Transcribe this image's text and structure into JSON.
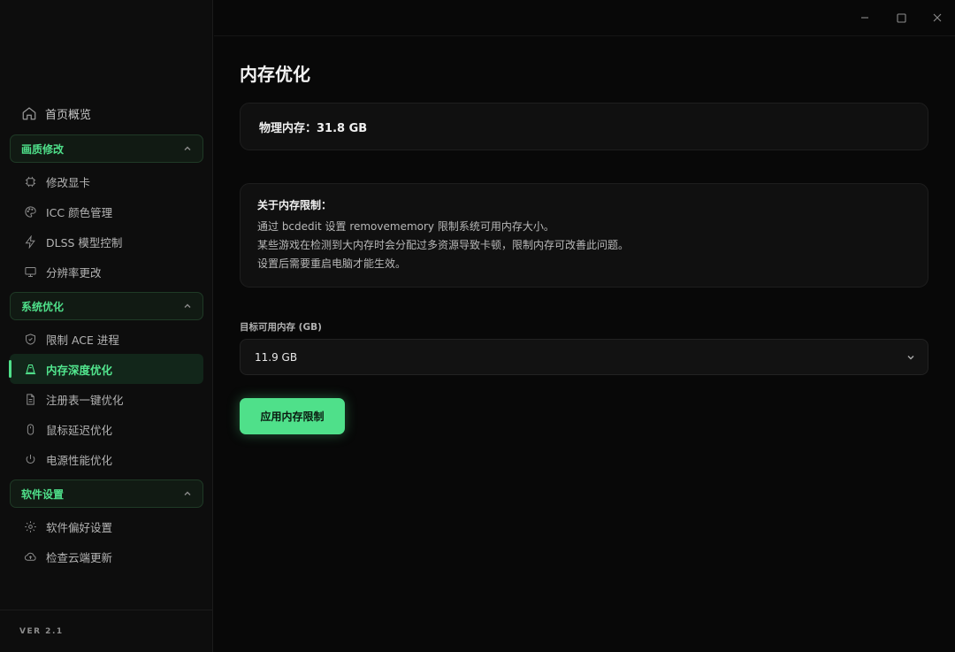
{
  "sidebar": {
    "home": {
      "label": "首页概览",
      "icon": "home-icon"
    },
    "groups": [
      {
        "label": "画质修改",
        "items": [
          {
            "label": "修改显卡",
            "icon": "chip-icon"
          },
          {
            "label": "ICC 颜色管理",
            "icon": "palette-icon"
          },
          {
            "label": "DLSS 模型控制",
            "icon": "lightning-icon"
          },
          {
            "label": "分辨率更改",
            "icon": "monitor-icon"
          }
        ]
      },
      {
        "label": "系统优化",
        "items": [
          {
            "label": "限制 ACE 进程",
            "icon": "shield-icon"
          },
          {
            "label": "内存深度优化",
            "icon": "memory-icon",
            "active": true
          },
          {
            "label": "注册表一键优化",
            "icon": "document-icon"
          },
          {
            "label": "鼠标延迟优化",
            "icon": "mouse-icon"
          },
          {
            "label": "电源性能优化",
            "icon": "power-icon"
          }
        ]
      },
      {
        "label": "软件设置",
        "items": [
          {
            "label": "软件偏好设置",
            "icon": "gear-icon"
          },
          {
            "label": "检查云端更新",
            "icon": "cloud-upload-icon"
          }
        ]
      }
    ],
    "version": "VER 2.1"
  },
  "main": {
    "title": "内存优化",
    "memory_card": "物理内存：31.8 GB",
    "info": {
      "title": "关于内存限制：",
      "lines": [
        "通过 bcdedit 设置 removememory 限制系统可用内存大小。",
        "某些游戏在检测到大内存时会分配过多资源导致卡顿，限制内存可改善此问题。",
        "设置后需要重启电脑才能生效。"
      ]
    },
    "field_label": "目标可用内存 (GB)",
    "select_value": "11.9 GB",
    "apply_label": "应用内存限制"
  },
  "colors": {
    "accent": "#4fe08a",
    "background": "#080808",
    "card": "#101010"
  }
}
